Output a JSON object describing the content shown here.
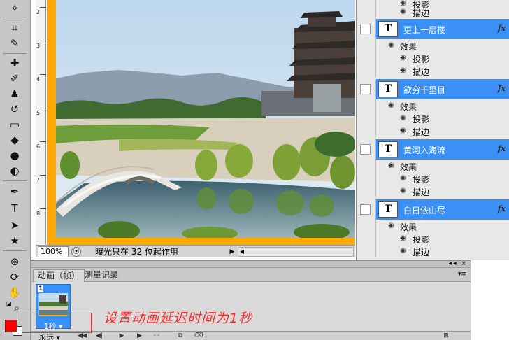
{
  "canvas": {
    "zoom": "100%",
    "status_message": "曝光只在 32 位起作用",
    "ruler_labels": [
      "2",
      "3",
      "4",
      "5",
      "6",
      "7",
      "8"
    ]
  },
  "layers": {
    "top_effects": [
      "投影",
      "描边"
    ],
    "items": [
      {
        "name": "更上一层楼",
        "effects_label": "效果",
        "effects": [
          "投影",
          "描边"
        ]
      },
      {
        "name": "欲穷千里目",
        "effects_label": "效果",
        "effects": [
          "投影",
          "描边"
        ]
      },
      {
        "name": "黄河入海流",
        "effects_label": "效果",
        "effects": [
          "投影",
          "描边"
        ]
      },
      {
        "name": "白日依山尽",
        "effects_label": "效果",
        "effects": [
          "投影",
          "描边"
        ]
      }
    ],
    "thumb_glyph": "T",
    "fx_label": "fx"
  },
  "animation_panel": {
    "tabs": [
      "动画（帧）",
      "测量记录"
    ],
    "frame_number": "1",
    "frame_delay": "1秒",
    "loop": "永远"
  },
  "annotation": "设置动画延迟时间为1秒",
  "colors": {
    "foreground": "#ff0000",
    "background": "#ffffff",
    "selection": "#3a90f5",
    "canvas_border": "#ffa800"
  }
}
